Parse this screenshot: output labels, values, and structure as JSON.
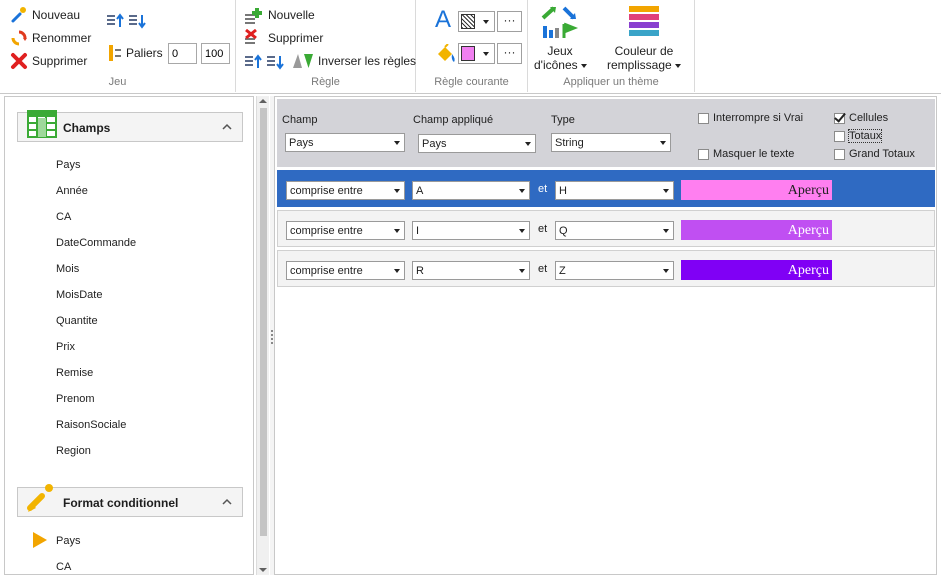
{
  "ribbon": {
    "jeu": {
      "label": "Jeu",
      "nouveau": "Nouveau",
      "renommer": "Renommer",
      "supprimer": "Supprimer",
      "paliers": "Paliers",
      "paliers_min": "0",
      "paliers_max": "100"
    },
    "regle": {
      "label": "Règle",
      "nouvelle": "Nouvelle",
      "supprimer": "Supprimer",
      "inverser": "Inverser les règles"
    },
    "regle_courante": {
      "label": "Règle courante",
      "font_letter": "A",
      "text_color_more": "···",
      "fill_color_more": "···",
      "fill_color": "#f07ff0"
    },
    "theme": {
      "label": "Appliquer un thème",
      "jeux_icones_1": "Jeux",
      "jeux_icones_2": "d'icônes",
      "couleur_1": "Couleur de",
      "couleur_2": "remplissage"
    }
  },
  "left": {
    "champs_title": "Champs",
    "fields": [
      "Pays",
      "Année",
      "CA",
      "DateCommande",
      "Mois",
      "MoisDate",
      "Quantite",
      "Prix",
      "Remise",
      "Prenom",
      "RaisonSociale",
      "Region"
    ],
    "format_title": "Format conditionnel",
    "format_items": [
      "Pays",
      "CA"
    ]
  },
  "right": {
    "headers": {
      "champ": "Champ",
      "champ_applique": "Champ appliqué",
      "type": "Type"
    },
    "champ_value": "Pays",
    "champ_applique_value": "Pays",
    "type_value": "String",
    "options": {
      "interrompre": "Interrompre si Vrai",
      "masquer": "Masquer le texte",
      "cellules": "Cellules",
      "totaux": "Totaux",
      "grand_totaux": "Grand Totaux"
    },
    "rules": [
      {
        "operator": "comprise entre",
        "from": "A",
        "et": "et",
        "to": "H",
        "preview": "Aperçu",
        "preview_bg": "#ff7ff0",
        "preview_fg": "#202020"
      },
      {
        "operator": "comprise entre",
        "from": "I",
        "et": "et",
        "to": "Q",
        "preview": "Aperçu",
        "preview_bg": "#c04ff2",
        "preview_fg": "#ffffff"
      },
      {
        "operator": "comprise entre",
        "from": "R",
        "et": "et",
        "to": "Z",
        "preview": "Aperçu",
        "preview_bg": "#8000f5",
        "preview_fg": "#ffffff"
      }
    ]
  }
}
